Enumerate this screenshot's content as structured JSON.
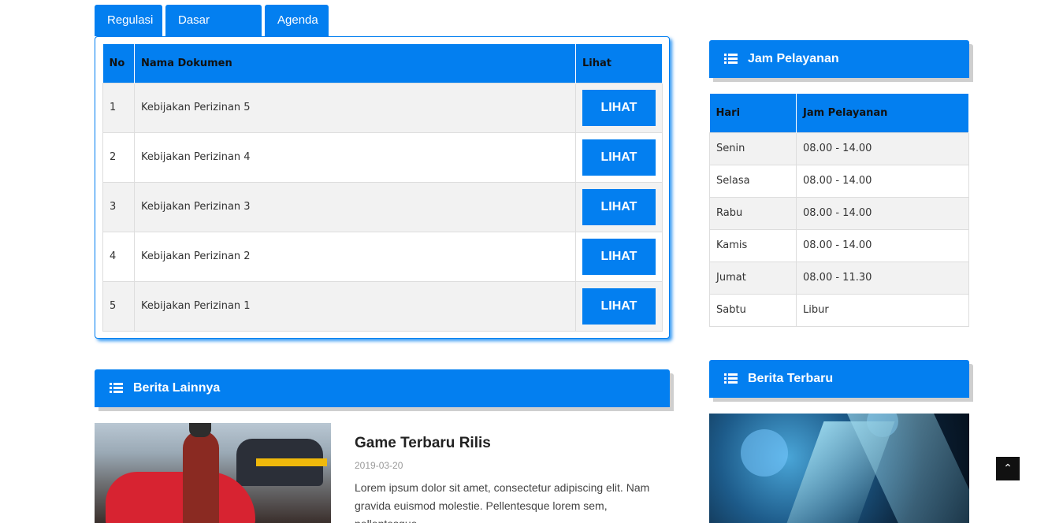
{
  "tabs": [
    "Regulasi",
    "Dasar Hukum",
    "Agenda"
  ],
  "documents": {
    "headers": [
      "No",
      "Nama Dokumen",
      "Lihat"
    ],
    "rows": [
      {
        "no": "1",
        "name": "Kebijakan Perizinan 5",
        "action": "LIHAT"
      },
      {
        "no": "2",
        "name": "Kebijakan Perizinan 4",
        "action": "LIHAT"
      },
      {
        "no": "3",
        "name": "Kebijakan Perizinan 3",
        "action": "LIHAT"
      },
      {
        "no": "4",
        "name": "Kebijakan Perizinan 2",
        "action": "LIHAT"
      },
      {
        "no": "5",
        "name": "Kebijakan Perizinan 1",
        "action": "LIHAT"
      }
    ]
  },
  "jam_pelayanan": {
    "title": "Jam Pelayanan",
    "headers": [
      "Hari",
      "Jam Pelayanan"
    ],
    "rows": [
      {
        "hari": "Senin",
        "jam": "08.00 - 14.00"
      },
      {
        "hari": "Selasa",
        "jam": "08.00 - 14.00"
      },
      {
        "hari": "Rabu",
        "jam": "08.00 - 14.00"
      },
      {
        "hari": "Kamis",
        "jam": "08.00 - 14.00"
      },
      {
        "hari": "Jumat",
        "jam": "08.00 - 11.30"
      },
      {
        "hari": "Sabtu",
        "jam": "Libur"
      }
    ]
  },
  "berita_lainnya": {
    "title": "Berita Lainnya",
    "article": {
      "title": "Game Terbaru Rilis",
      "date": "2019-03-20",
      "excerpt": "Lorem ipsum dolor sit amet, consectetur adipiscing elit. Nam gravida euismod molestie. Pellentesque lorem sem, pellentesque"
    }
  },
  "berita_terbaru": {
    "title": "Berita Terbaru"
  },
  "icons": {
    "widget": "list-icon",
    "back_to_top": "chevron-up-icon"
  },
  "colors": {
    "accent": "#037ff0",
    "row_alt": "#f2f2f2"
  }
}
